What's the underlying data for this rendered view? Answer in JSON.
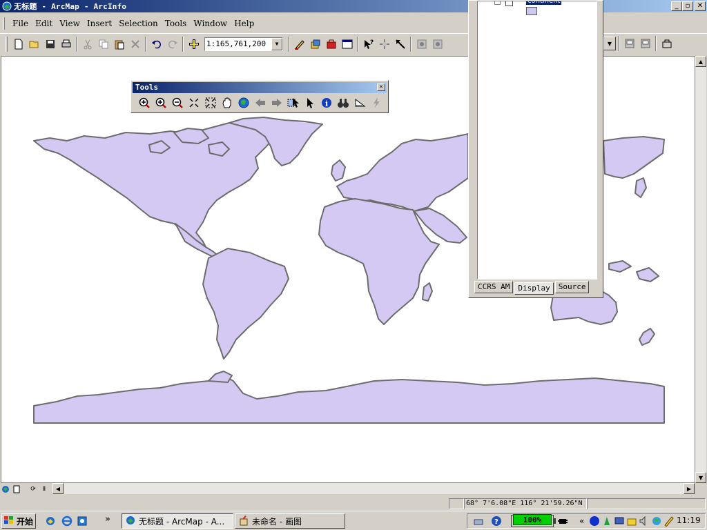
{
  "window": {
    "title": "无标题 - ArcMap - ArcInfo",
    "minimize": "_",
    "maximize": "▫",
    "close": "✕"
  },
  "menu": [
    "File",
    "Edit",
    "View",
    "Insert",
    "Selection",
    "Tools",
    "Window",
    "Help"
  ],
  "toolbar": {
    "scale": "1:165,761,200",
    "icons": [
      "new-icon",
      "open-icon",
      "save-icon",
      "print-icon",
      "cut-icon",
      "copy-icon",
      "paste-icon",
      "delete-icon",
      "undo-icon",
      "redo-icon",
      "add-data-icon",
      "editor-icon",
      "arctoolbox-icon",
      "arccatalog-icon",
      "command-line-icon",
      "whats-this-icon",
      "identify-icon",
      "hyperlink-icon"
    ]
  },
  "tools_window": {
    "title": "Tools",
    "close": "✕",
    "tools": [
      "zoom-in-fixed-icon",
      "zoom-in-icon",
      "zoom-out-icon",
      "fixed-zoom-in-icon",
      "fixed-zoom-out-icon",
      "pan-icon",
      "full-extent-icon",
      "back-icon",
      "forward-icon",
      "select-features-icon",
      "select-elements-icon",
      "identify-icon",
      "find-icon",
      "measure-icon",
      "hyperlink-icon"
    ]
  },
  "toc": {
    "layer_label": "continent",
    "swatch_color": "#d0c8f0",
    "tabs": [
      {
        "label": "CCRS AM",
        "active": false
      },
      {
        "label": "Display",
        "active": true
      },
      {
        "label": "Source",
        "active": false
      }
    ]
  },
  "map": {
    "land_color": "#d3c9f3",
    "outline_color": "#6c6c6c"
  },
  "status": {
    "coordinates": "68° 7'6.08\"E  116° 21'59.26\"N"
  },
  "taskbar": {
    "start_label": "开始",
    "tasks": [
      {
        "label": "无标题 - ArcMap - A...",
        "active": true
      },
      {
        "label": "未命名 - 画图",
        "active": false
      }
    ],
    "more": "»",
    "tray_more": "«",
    "battery": "100%",
    "clock": "11:19"
  }
}
